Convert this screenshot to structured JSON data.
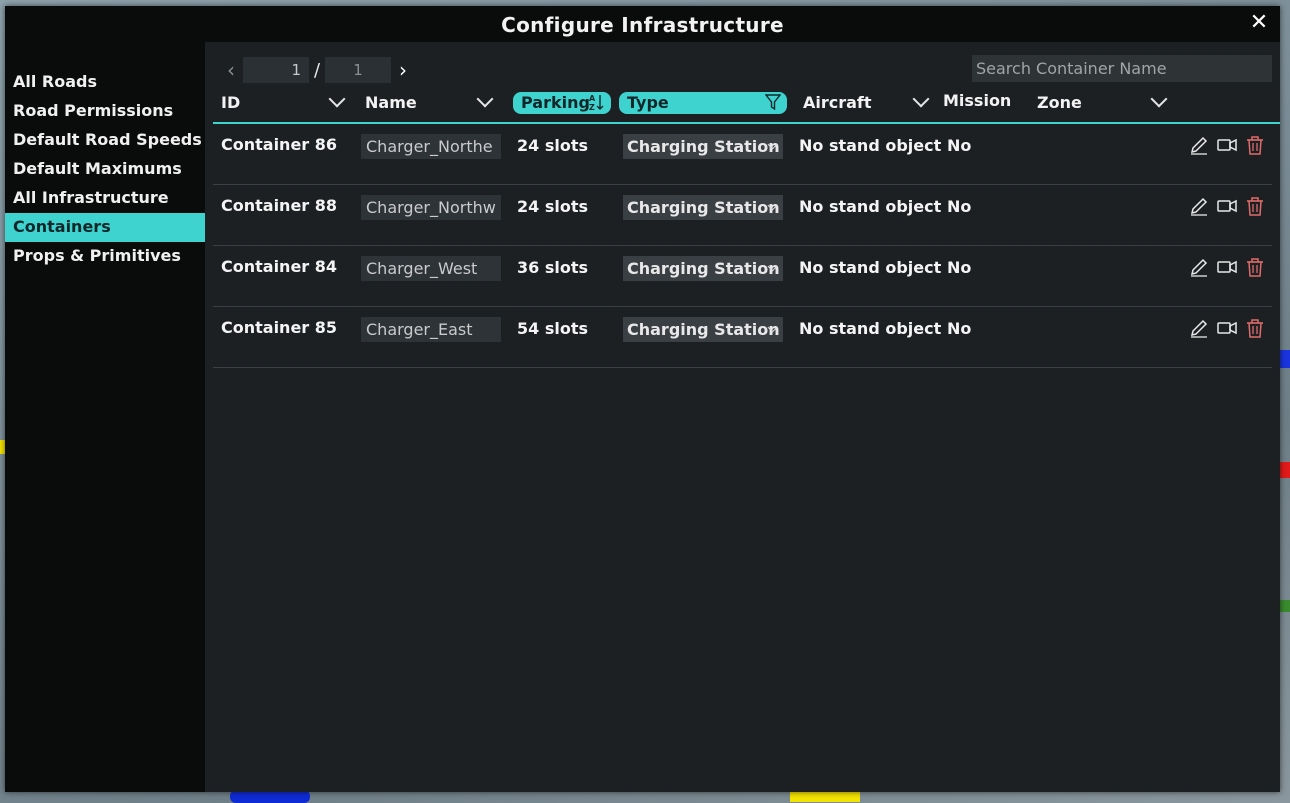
{
  "dialog": {
    "title": "Configure Infrastructure"
  },
  "sidebar": {
    "items": [
      {
        "label": "All Roads"
      },
      {
        "label": "Road Permissions"
      },
      {
        "label": "Default Road Speeds"
      },
      {
        "label": "Default Maximums"
      },
      {
        "label": "All Infrastructure"
      },
      {
        "label": "Containers",
        "active": true
      },
      {
        "label": "Props & Primitives"
      }
    ]
  },
  "pager": {
    "current": "1",
    "separator": "/",
    "total": "1"
  },
  "search": {
    "placeholder": "Search Container Name",
    "value": ""
  },
  "columns": {
    "id": "ID",
    "name": "Name",
    "parking": "Parking",
    "type": "Type",
    "aircraft": "Aircraft",
    "mission": "Mission",
    "zone": "Zone"
  },
  "rows": [
    {
      "id": "Container 86",
      "name": "Charger_Northe",
      "parking": "24 slots",
      "type": "Charging Station",
      "aircraft": "No stand object",
      "mission": "No",
      "zone": ""
    },
    {
      "id": "Container 88",
      "name": "Charger_Northw",
      "parking": "24 slots",
      "type": "Charging Station",
      "aircraft": "No stand object",
      "mission": "No",
      "zone": ""
    },
    {
      "id": "Container 84",
      "name": "Charger_West",
      "parking": "36 slots",
      "type": "Charging Station",
      "aircraft": "No stand object",
      "mission": "No",
      "zone": ""
    },
    {
      "id": "Container 85",
      "name": "Charger_East",
      "parking": "54 slots",
      "type": "Charging Station",
      "aircraft": "No stand object",
      "mission": "No",
      "zone": ""
    }
  ],
  "colors": {
    "accent": "#3fd3d0",
    "panel": "#1c2023",
    "sidebar": "#0a0b0b",
    "delete": "#e06b6b"
  }
}
